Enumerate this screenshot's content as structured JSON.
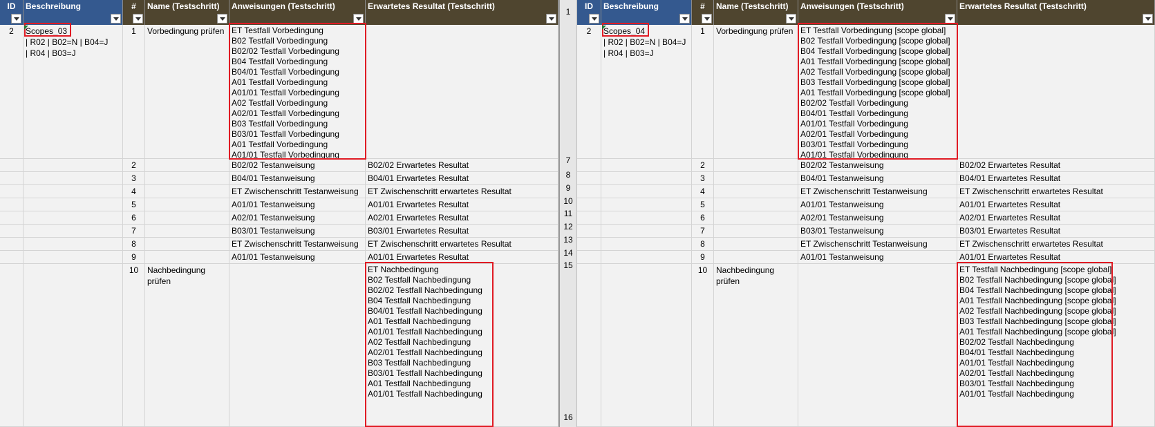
{
  "headers": {
    "id": "ID",
    "beschreibung": "Beschreibung",
    "nr": "#",
    "name": "Name (Testschritt)",
    "anweisungen": "Anweisungen (Testschritt)",
    "resultat": "Erwartetes Resultat (Testschritt)"
  },
  "gutter_rows": [
    "1",
    "7",
    "8",
    "9",
    "10",
    "11",
    "12",
    "13",
    "14",
    "15",
    "16"
  ],
  "left": {
    "id": "2",
    "scope_name": "Scopes_03",
    "desc_line1": "| R02 | B02=N | B04=J",
    "desc_line2": "| R04 | B03=J",
    "step1": {
      "nr": "1",
      "name": "Vorbedingung prüfen",
      "anweisungen": [
        "ET Testfall Vorbedingung",
        "B02 Testfall Vorbedingung",
        "B02/02 Testfall Vorbedingung",
        "B04 Testfall Vorbedingung",
        "B04/01 Testfall Vorbedingung",
        "A01 Testfall Vorbedingung",
        "A01/01 Testfall Vorbedingung",
        "A02 Testfall Vorbedingung",
        "A02/01 Testfall Vorbedingung",
        "B03 Testfall Vorbedingung",
        "B03/01 Testfall Vorbedingung",
        "A01 Testfall Vorbedingung",
        "A01/01 Testfall Vorbedingung"
      ]
    },
    "steps": [
      {
        "nr": "2",
        "anweisung": "B02/02 Testanweisung",
        "resultat": "B02/02 Erwartetes Resultat"
      },
      {
        "nr": "3",
        "anweisung": "B04/01 Testanweisung",
        "resultat": "B04/01 Erwartetes Resultat"
      },
      {
        "nr": "4",
        "anweisung": "ET Zwischenschritt Testanweisung",
        "resultat": "ET Zwischenschritt erwartetes Resultat"
      },
      {
        "nr": "5",
        "anweisung": "A01/01 Testanweisung",
        "resultat": "A01/01 Erwartetes Resultat"
      },
      {
        "nr": "6",
        "anweisung": "A02/01 Testanweisung",
        "resultat": "A02/01 Erwartetes Resultat"
      },
      {
        "nr": "7",
        "anweisung": "B03/01 Testanweisung",
        "resultat": "B03/01 Erwartetes Resultat"
      },
      {
        "nr": "8",
        "anweisung": "ET Zwischenschritt Testanweisung",
        "resultat": "ET Zwischenschritt erwartetes Resultat"
      },
      {
        "nr": "9",
        "anweisung": "A01/01 Testanweisung",
        "resultat": "A01/01 Erwartetes Resultat"
      }
    ],
    "step10": {
      "nr": "10",
      "name_line1": "Nachbedingung",
      "name_line2": "prüfen",
      "resultate": [
        "ET Nachbedingung",
        "B02 Testfall Nachbedingung",
        "B02/02 Testfall Nachbedingung",
        "B04 Testfall Nachbedingung",
        "B04/01 Testfall Nachbedingung",
        "A01 Testfall Nachbedingung",
        "A01/01 Testfall Nachbedingung",
        "A02 Testfall Nachbedingung",
        "A02/01 Testfall Nachbedingung",
        "B03 Testfall Nachbedingung",
        "B03/01 Testfall Nachbedingung",
        "A01 Testfall Nachbedingung",
        "A01/01 Testfall Nachbedingung"
      ]
    }
  },
  "right": {
    "id": "2",
    "scope_name": "Scopes_04",
    "desc_line1": "| R02 | B02=N | B04=J",
    "desc_line2": "| R04 | B03=J",
    "step1": {
      "nr": "1",
      "name": "Vorbedingung prüfen",
      "anweisungen": [
        "ET Testfall Vorbedingung [scope global]",
        "B02 Testfall Vorbedingung [scope global]",
        "B04 Testfall Vorbedingung [scope global]",
        "A01 Testfall Vorbedingung [scope global]",
        "A02 Testfall Vorbedingung [scope global]",
        "B03 Testfall Vorbedingung [scope global]",
        "A01 Testfall Vorbedingung [scope global]",
        "B02/02 Testfall Vorbedingung",
        "B04/01 Testfall Vorbedingung",
        "A01/01 Testfall Vorbedingung",
        "A02/01 Testfall Vorbedingung",
        "B03/01 Testfall Vorbedingung",
        "A01/01 Testfall Vorbedingung"
      ]
    },
    "steps": [
      {
        "nr": "2",
        "anweisung": "B02/02 Testanweisung",
        "resultat": "B02/02 Erwartetes Resultat"
      },
      {
        "nr": "3",
        "anweisung": "B04/01 Testanweisung",
        "resultat": "B04/01 Erwartetes Resultat"
      },
      {
        "nr": "4",
        "anweisung": "ET Zwischenschritt Testanweisung",
        "resultat": "ET Zwischenschritt erwartetes Resultat"
      },
      {
        "nr": "5",
        "anweisung": "A01/01 Testanweisung",
        "resultat": "A01/01 Erwartetes Resultat"
      },
      {
        "nr": "6",
        "anweisung": "A02/01 Testanweisung",
        "resultat": "A02/01 Erwartetes Resultat"
      },
      {
        "nr": "7",
        "anweisung": "B03/01 Testanweisung",
        "resultat": "B03/01 Erwartetes Resultat"
      },
      {
        "nr": "8",
        "anweisung": "ET Zwischenschritt Testanweisung",
        "resultat": "ET Zwischenschritt erwartetes Resultat"
      },
      {
        "nr": "9",
        "anweisung": "A01/01 Testanweisung",
        "resultat": "A01/01 Erwartetes Resultat"
      }
    ],
    "step10": {
      "nr": "10",
      "name_line1": "Nachbedingung",
      "name_line2": "prüfen",
      "resultate": [
        "ET Testfall Nachbedingung [scope global]",
        "B02 Testfall Nachbedingung [scope global]",
        "B04 Testfall Nachbedingung [scope global]",
        "A01 Testfall Nachbedingung [scope global]",
        "A02 Testfall Nachbedingung [scope global]",
        "B03 Testfall Nachbedingung [scope global]",
        "A01 Testfall Nachbedingung [scope global]",
        "B02/02 Testfall Nachbedingung",
        "B04/01 Testfall Nachbedingung",
        "A01/01 Testfall Nachbedingung",
        "A02/01 Testfall Nachbedingung",
        "B03/01 Testfall Nachbedingung",
        "A01/01 Testfall Nachbedingung"
      ]
    }
  },
  "colors": {
    "header_blue": "#34598f",
    "header_brown": "#4f452f",
    "highlight_red": "#e01b24",
    "cell_bg": "#f2f2f2"
  }
}
